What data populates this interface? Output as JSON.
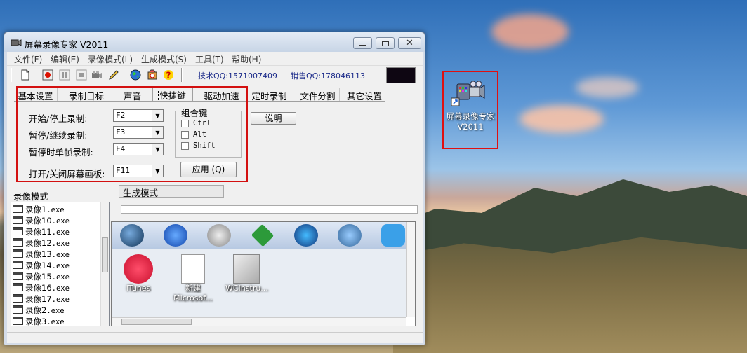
{
  "window": {
    "title": "屏幕录像专家 V2011"
  },
  "menu": [
    "文件(F)",
    "编辑(E)",
    "录像模式(L)",
    "生成模式(S)",
    "工具(T)",
    "帮助(H)"
  ],
  "toolbar": {
    "tech_qq": "技术QQ:1571007409",
    "sales_qq": "销售QQ:178046113"
  },
  "tabs": [
    "基本设置",
    "录制目标",
    "声音",
    "快捷键",
    "驱动加速",
    "定时录制",
    "文件分割",
    "其它设置"
  ],
  "active_tab": "快捷键",
  "hotkeys": [
    {
      "label": "开始/停止录制:",
      "value": "F2"
    },
    {
      "label": "暂停/继续录制:",
      "value": "F3"
    },
    {
      "label": "暂停时单帧录制:",
      "value": "F4"
    },
    {
      "label": "打开/关闭屏幕画板:",
      "value": "F11"
    }
  ],
  "combo_group": {
    "legend": "组合键",
    "options": [
      "Ctrl",
      "Alt",
      "Shift"
    ]
  },
  "buttons": {
    "apply": "应用 (Q)",
    "explain": "说明"
  },
  "lower": {
    "left_header": "录像模式",
    "right_header": "生成模式",
    "files": [
      {
        "name": "录像1",
        "ext": ".exe"
      },
      {
        "name": "录像10",
        "ext": ".exe"
      },
      {
        "name": "录像11",
        "ext": ".exe"
      },
      {
        "name": "录像12",
        "ext": ".exe"
      },
      {
        "name": "录像13",
        "ext": ".exe"
      },
      {
        "name": "录像14",
        "ext": ".exe"
      },
      {
        "name": "录像15",
        "ext": ".exe"
      },
      {
        "name": "录像16",
        "ext": ".exe"
      },
      {
        "name": "录像17",
        "ext": ".exe"
      },
      {
        "name": "录像2",
        "ext": ".exe"
      },
      {
        "name": "录像3",
        "ext": ".exe"
      }
    ]
  },
  "preview": {
    "desktop_icons": [
      "iTunes",
      "新建 Microsof...",
      "WCInstru..."
    ]
  },
  "desktop_icon": {
    "label": "屏幕录像专家 V2011"
  },
  "colors": {
    "highlight_border": "#d31010",
    "qq_text": "#1c2b8a"
  }
}
